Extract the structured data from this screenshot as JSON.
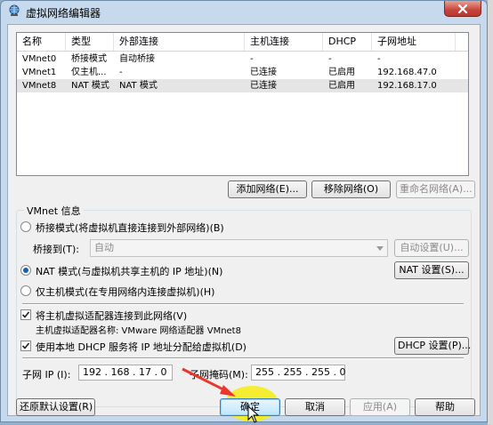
{
  "window": {
    "title": "虚拟网络编辑器",
    "close_icon": "close-x-icon"
  },
  "list": {
    "columns": [
      "名称",
      "类型",
      "外部连接",
      "主机连接",
      "DHCP",
      "子网地址"
    ],
    "rows": [
      [
        "VMnet0",
        "桥接模式",
        "自动桥接",
        "-",
        "-",
        "-"
      ],
      [
        "VMnet1",
        "仅主机...",
        "-",
        "已连接",
        "已启用",
        "192.168.47.0"
      ],
      [
        "VMnet8",
        "NAT 模式",
        "NAT 模式",
        "已连接",
        "已启用",
        "192.168.17.0"
      ]
    ]
  },
  "list_buttons": {
    "add": "添加网络(E)...",
    "remove": "移除网络(O)",
    "rename": "重命名网络(A)..."
  },
  "vmnet_info": {
    "group_label": "VMnet 信息",
    "bridged_label": "桥接模式(将虚拟机直接连接到外部网络)(B)",
    "bridged_to_label": "桥接到(T):",
    "bridged_to_value": "自动",
    "auto_settings": "自动设置(U)...",
    "nat_label": "NAT 模式(与虚拟机共享主机的 IP 地址)(N)",
    "nat_settings": "NAT 设置(S)...",
    "hostonly_label": "仅主机模式(在专用网络内连接虚拟机)(H)",
    "selected_mode": "nat",
    "connect_adapter_label": "将主机虚拟适配器连接到此网络(V)",
    "connect_adapter_checked": true,
    "adapter_name_label": "主机虚拟适配器名称: VMware 网络适配器 VMnet8",
    "dhcp_label": "使用本地 DHCP 服务将 IP 地址分配给虚拟机(D)",
    "dhcp_checked": true,
    "dhcp_settings": "DHCP 设置(P)...",
    "subnet_ip_label": "子网 IP (I):",
    "subnet_ip_value": "192 . 168 . 17 . 0",
    "subnet_mask_label": "子网掩码(M):",
    "subnet_mask_value": "255 . 255 . 255 . 0"
  },
  "footer": {
    "restore": "还原默认设置(R)",
    "ok": "确定",
    "cancel": "取消",
    "apply": "应用(A)",
    "help": "帮助"
  },
  "colors": {
    "accent": "#1a5fb4",
    "highlight": "#f5ec1c",
    "arrow": "#e8372c"
  }
}
